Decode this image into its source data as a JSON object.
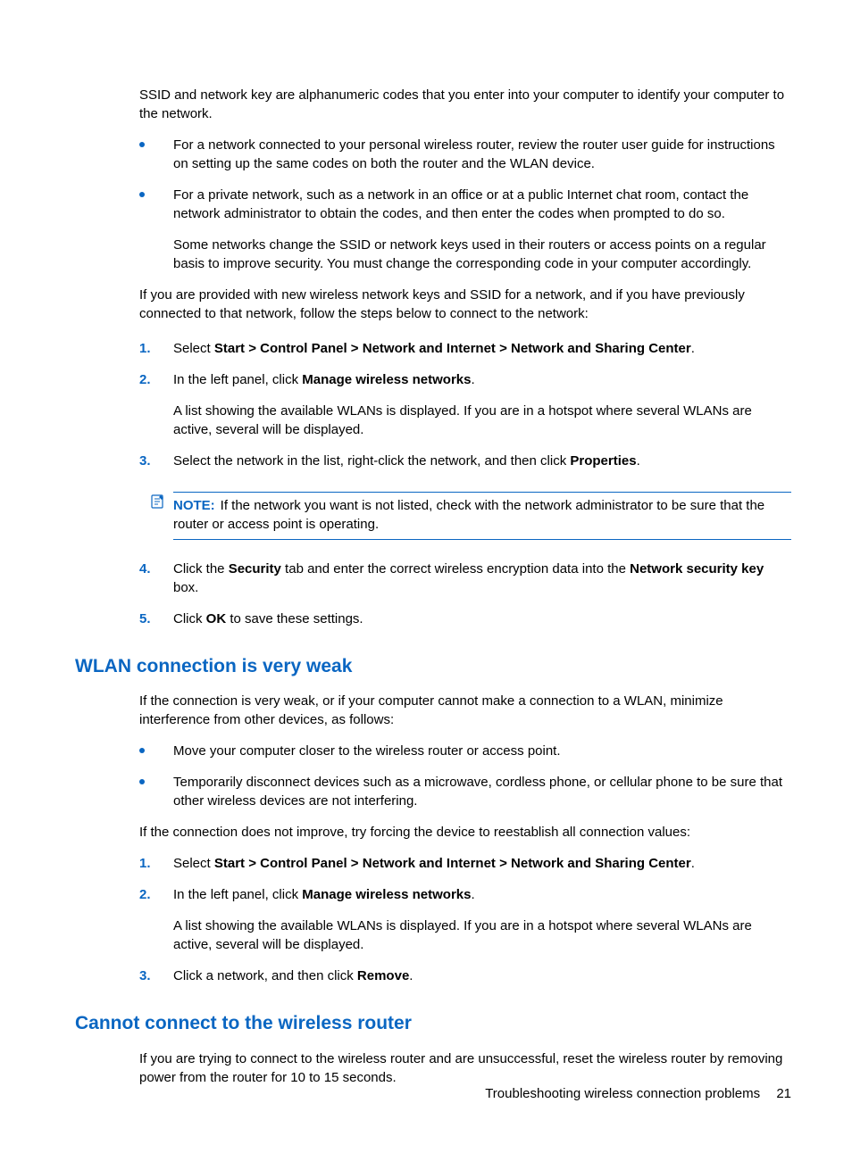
{
  "intro": {
    "ssid": "SSID and network key are alphanumeric codes that you enter into your computer to identify your computer to the network.",
    "bullet1": "For a network connected to your personal wireless router, review the router user guide for instructions on setting up the same codes on both the router and the WLAN device.",
    "bullet2": "For a private network, such as a network in an office or at a public Internet chat room, contact the network administrator to obtain the codes, and then enter the codes when prompted to do so.",
    "bullet2_sub": "Some networks change the SSID or network keys used in their routers or access points on a regular basis to improve security. You must change the corresponding code in your computer accordingly.",
    "provided": "If you are provided with new wireless network keys and SSID for a network, and if you have previously connected to that network, follow the steps below to connect to the network:"
  },
  "steps1": {
    "s1a": "Select ",
    "s1b": "Start > Control Panel > Network and Internet > Network and Sharing Center",
    "s1c": ".",
    "s2a": "In the left panel, click ",
    "s2b": "Manage wireless networks",
    "s2c": ".",
    "s2_sub": "A list showing the available WLANs is displayed. If you are in a hotspot where several WLANs are active, several will be displayed.",
    "s3a": "Select the network in the list, right-click the network, and then click ",
    "s3b": "Properties",
    "s3c": ".",
    "note_label": "NOTE:",
    "note_text": "If the network you want is not listed, check with the network administrator to be sure that the router or access point is operating.",
    "s4a": "Click the ",
    "s4b": "Security",
    "s4c": " tab and enter the correct wireless encryption data into the ",
    "s4d": "Network security key",
    "s4e": " box.",
    "s5a": "Click ",
    "s5b": "OK",
    "s5c": " to save these settings."
  },
  "weak": {
    "heading": "WLAN connection is very weak",
    "intro": "If the connection is very weak, or if your computer cannot make a connection to a WLAN, minimize interference from other devices, as follows:",
    "b1": "Move your computer closer to the wireless router or access point.",
    "b2": "Temporarily disconnect devices such as a microwave, cordless phone, or cellular phone to be sure that other wireless devices are not interfering.",
    "after": "If the connection does not improve, try forcing the device to reestablish all connection values:",
    "s1a": "Select ",
    "s1b": "Start > Control Panel > Network and Internet > Network and Sharing Center",
    "s1c": ".",
    "s2a": "In the left panel, click ",
    "s2b": "Manage wireless networks",
    "s2c": ".",
    "s2_sub": "A list showing the available WLANs is displayed. If you are in a hotspot where several WLANs are active, several will be displayed.",
    "s3a": "Click a network, and then click ",
    "s3b": "Remove",
    "s3c": "."
  },
  "router": {
    "heading": "Cannot connect to the wireless router",
    "text": "If you are trying to connect to the wireless router and are unsuccessful, reset the wireless router by removing power from the router for 10 to 15 seconds."
  },
  "footer": {
    "title": "Troubleshooting wireless connection problems",
    "page": "21"
  },
  "nums": {
    "n1": "1.",
    "n2": "2.",
    "n3": "3.",
    "n4": "4.",
    "n5": "5."
  }
}
